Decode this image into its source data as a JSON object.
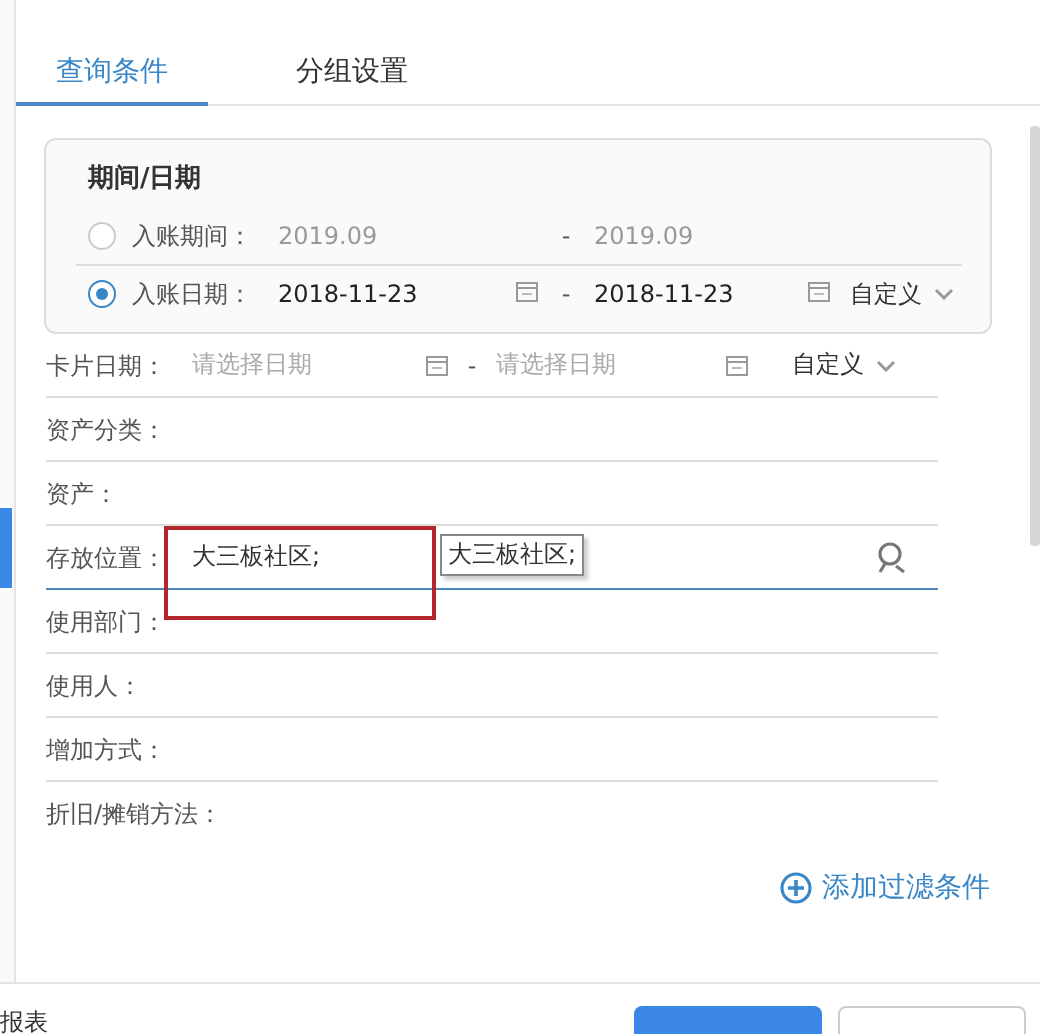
{
  "tabs": [
    {
      "label": "查询条件",
      "selected": true
    },
    {
      "label": "分组设置",
      "selected": false
    }
  ],
  "period_card": {
    "title": "期间/日期",
    "options": [
      {
        "label": "入账期间：",
        "selected": false,
        "from": "2019.09",
        "separator": "-",
        "to": "2019.09"
      },
      {
        "label": "入账日期：",
        "selected": true,
        "from": "2018-11-23",
        "separator": "-",
        "to": "2018-11-23",
        "mode": "自定义"
      }
    ]
  },
  "filters": [
    {
      "kind": "date_range",
      "label": "卡片日期：",
      "from_placeholder": "请选择日期",
      "separator": "-",
      "to_placeholder": "请选择日期",
      "mode": "自定义"
    },
    {
      "kind": "text",
      "label": "资产分类："
    },
    {
      "kind": "text",
      "label": "资产："
    },
    {
      "kind": "lookup",
      "label": "存放位置：",
      "value": "大三板社区;",
      "focused": true,
      "tooltip": "大三板社区;"
    },
    {
      "kind": "text",
      "label": "使用部门："
    },
    {
      "kind": "text",
      "label": "使用人："
    },
    {
      "kind": "text",
      "label": "增加方式："
    },
    {
      "kind": "text",
      "label": "折旧/摊销方法：",
      "last": true
    }
  ],
  "add_filter": "添加过滤条件",
  "footer": {
    "left_text": "报表",
    "buttons": [
      {
        "kind": "primary"
      },
      {
        "kind": "secondary"
      }
    ]
  }
}
